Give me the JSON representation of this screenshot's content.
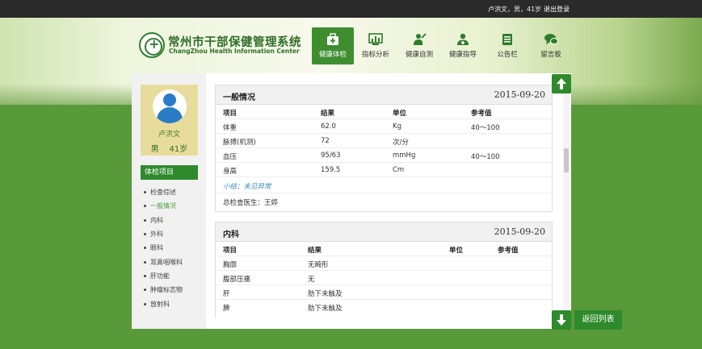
{
  "topbar": {
    "user_info": "卢洪文，男，41岁",
    "logout": "退出登录"
  },
  "logo": {
    "title_cn": "常州市干部保健管理系统",
    "title_en": "ChangZhou Health Information Center"
  },
  "nav": [
    {
      "label": "健康体检",
      "icon": "medical-kit-icon",
      "active": true
    },
    {
      "label": "指标分析",
      "icon": "chart-icon"
    },
    {
      "label": "健康自测",
      "icon": "self-test-icon"
    },
    {
      "label": "健康指导",
      "icon": "doctor-icon"
    },
    {
      "label": "公告栏",
      "icon": "notice-icon"
    },
    {
      "label": "留言板",
      "icon": "message-icon"
    }
  ],
  "profile": {
    "name": "卢洪文",
    "gender": "男",
    "age": "41岁"
  },
  "sidebar": {
    "heading": "体检项目",
    "items": [
      "检查综述",
      "一般情况",
      "内科",
      "外科",
      "眼科",
      "耳鼻咽喉科",
      "肝功能",
      "肿瘤标志物",
      "放射科"
    ],
    "active_index": 1
  },
  "general": {
    "title": "一般情况",
    "date": "2015-09-20",
    "columns": [
      "项目",
      "结果",
      "单位",
      "参考值"
    ],
    "rows": [
      [
        "体重",
        "62.0",
        "Kg",
        "40～100"
      ],
      [
        "脉搏(机测)",
        "72",
        "次/分",
        ""
      ],
      [
        "血压",
        "95/63",
        "mmHg",
        "40～100"
      ],
      [
        "身高",
        "159.5",
        "Cm",
        ""
      ]
    ],
    "summary": "小结：未见异常",
    "doctor": "总检查医生：王婷"
  },
  "internal": {
    "title": "内科",
    "date": "2015-09-20",
    "columns": [
      "项目",
      "结果",
      "单位",
      "参考值"
    ],
    "rows": [
      [
        "胸廓",
        "无畸形",
        "",
        ""
      ],
      [
        "腹部压痛",
        "无",
        "",
        ""
      ],
      [
        "肝",
        "肋下未触及",
        "",
        ""
      ],
      [
        "脾",
        "肋下未触及",
        "",
        ""
      ]
    ]
  },
  "actions": {
    "back_label": "返回列表"
  },
  "colors": {
    "accent": "#2e8a2a",
    "background": "#58993a",
    "profile_bg": "#e8dc9c",
    "avatar": "#2a7cc7"
  }
}
